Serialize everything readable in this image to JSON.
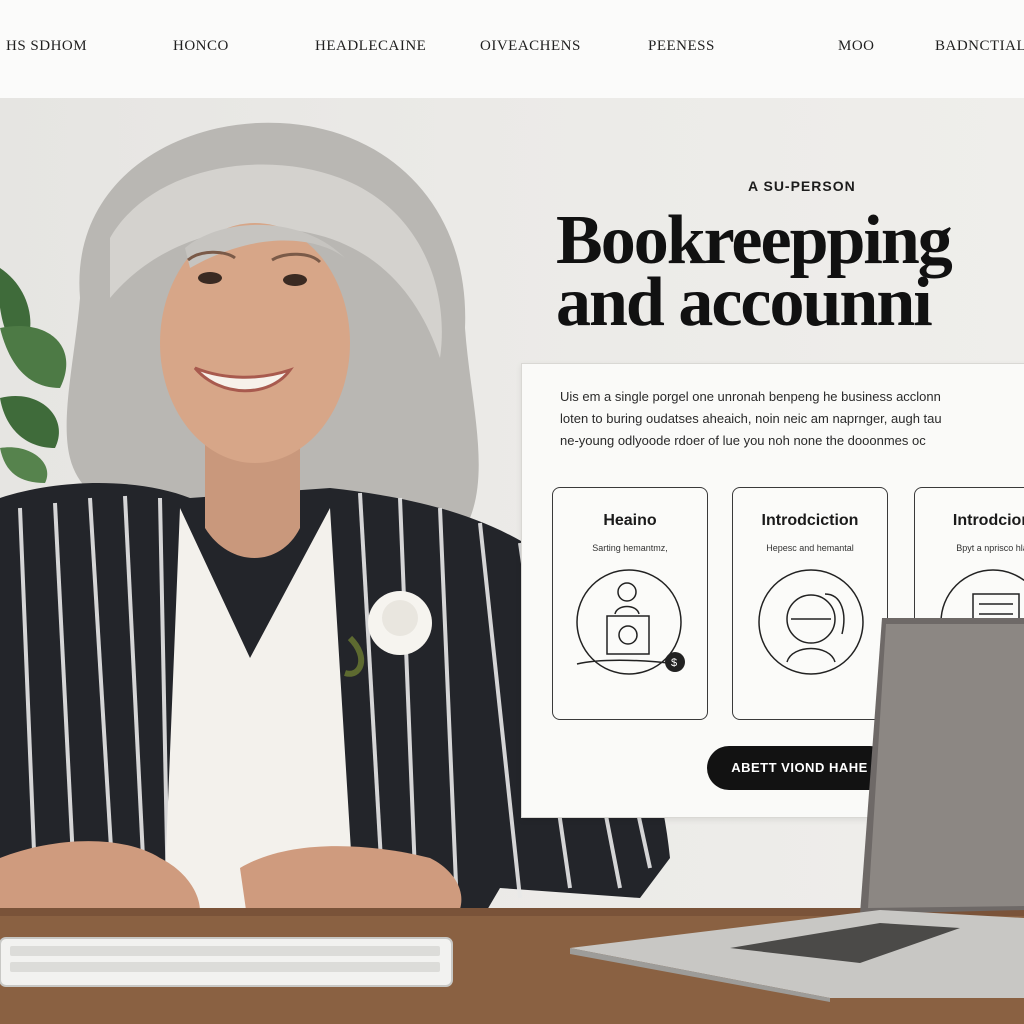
{
  "nav": {
    "items": [
      "HS SDHOM",
      "HONCO",
      "HEADLECAINE",
      "OIVEACHENS",
      "PEENESS",
      "MOO",
      "BADNCTIAL"
    ]
  },
  "hero": {
    "eyebrow": "A SU-PERSON",
    "headline_line1": "Bookreepping",
    "headline_line2": "and accounni"
  },
  "panel": {
    "copy": [
      "Uis em a single porgel one unronah benpeng he business acclonn",
      "loten to buring oudatses aheaich, noin neic am naprnger, augh tau",
      "ne-young odlyoode rdoer of lue you noh none the dooonmes oc"
    ],
    "cards": [
      {
        "title": "Heaino",
        "subtitle": "Sarting hemantmz,",
        "icon": "cashier-icon"
      },
      {
        "title": "Introdciction",
        "subtitle": "Hepesc and hemantal",
        "icon": "profile-icon"
      },
      {
        "title": "Introdcion",
        "subtitle": "Bpyt a nprisco hla",
        "icon": "document-icon"
      }
    ],
    "cta_label": "ABETT VIOND HAHE"
  },
  "colors": {
    "nav_bg": "#fbfbfa",
    "hero_bg": "#ebeae7",
    "cta_bg": "#121212",
    "headline": "#111111"
  }
}
